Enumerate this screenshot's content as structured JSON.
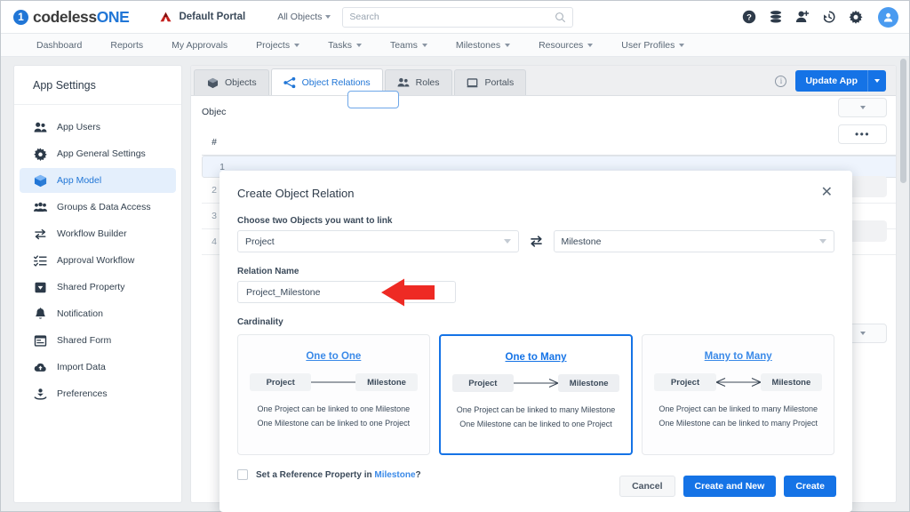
{
  "topbar": {
    "brand_mark": "1",
    "brand_primary": "codeless",
    "brand_accent": "ONE",
    "portal_name": "Default Portal",
    "portal_icon": "triangle-logo-icon",
    "object_selector": "All Objects",
    "search_placeholder": "Search",
    "search_value": "",
    "icons": [
      {
        "name": "help-icon",
        "glyph": "?"
      },
      {
        "name": "database-icon",
        "glyph": ""
      },
      {
        "name": "add-user-icon",
        "glyph": ""
      },
      {
        "name": "history-icon",
        "glyph": ""
      },
      {
        "name": "settings-gear-icon",
        "glyph": ""
      },
      {
        "name": "user-avatar-icon",
        "glyph": ""
      }
    ]
  },
  "nav": {
    "items": [
      {
        "label": "Dashboard",
        "has_caret": false
      },
      {
        "label": "Reports",
        "has_caret": false
      },
      {
        "label": "My Approvals",
        "has_caret": false
      },
      {
        "label": "Projects",
        "has_caret": true
      },
      {
        "label": "Tasks",
        "has_caret": true
      },
      {
        "label": "Teams",
        "has_caret": true
      },
      {
        "label": "Milestones",
        "has_caret": true
      },
      {
        "label": "Resources",
        "has_caret": true
      },
      {
        "label": "User Profiles",
        "has_caret": true
      }
    ]
  },
  "sidebar": {
    "title": "App Settings",
    "items": [
      {
        "label": "App Users",
        "icon": "users-icon",
        "active": false
      },
      {
        "label": "App General Settings",
        "icon": "gear-icon",
        "active": false
      },
      {
        "label": "App Model",
        "icon": "cube-icon",
        "active": true
      },
      {
        "label": "Groups & Data Access",
        "icon": "group-users-icon",
        "active": false
      },
      {
        "label": "Workflow Builder",
        "icon": "swap-arrows-icon",
        "active": false
      },
      {
        "label": "Approval Workflow",
        "icon": "checklist-icon",
        "active": false
      },
      {
        "label": "Shared Property",
        "icon": "tag-down-icon",
        "active": false
      },
      {
        "label": "Notification",
        "icon": "bell-icon",
        "active": false
      },
      {
        "label": "Shared Form",
        "icon": "form-icon",
        "active": false
      },
      {
        "label": "Import Data",
        "icon": "cloud-upload-icon",
        "active": false
      },
      {
        "label": "Preferences",
        "icon": "preferences-hand-icon",
        "active": false
      }
    ]
  },
  "main": {
    "tabs": [
      {
        "label": "Objects",
        "icon": "cube-icon",
        "active": false
      },
      {
        "label": "Object Relations",
        "icon": "relations-icon",
        "active": true
      },
      {
        "label": "Roles",
        "icon": "roles-users-icon",
        "active": false
      },
      {
        "label": "Portals",
        "icon": "portal-screen-icon",
        "active": false
      }
    ],
    "info_icon": "info-icon",
    "update_button": "Update App",
    "background": {
      "section_label": "Objec",
      "table_header": "#",
      "rows": [
        "1",
        "2",
        "3",
        "4"
      ],
      "more_actions": "•••"
    }
  },
  "modal": {
    "title": "Create Object Relation",
    "close_icon": "close-icon",
    "objects_label": "Choose two Objects you want to link",
    "object_left": "Project",
    "object_right": "Milestone",
    "swap_icon": "swap-arrows-icon",
    "relation_name_label": "Relation Name",
    "relation_name_value": "Project_Milestone",
    "cardinality_label": "Cardinality",
    "cards": [
      {
        "title": "One to One",
        "left": "Project",
        "right": "Milestone",
        "connector": "line",
        "line1": "One Project can be linked to one Milestone",
        "line2": "One Milestone can be linked to one Project",
        "selected": false
      },
      {
        "title": "One to Many",
        "left": "Project",
        "right": "Milestone",
        "connector": "crowfoot-right",
        "line1": "One Project can be linked to many Milestone",
        "line2": "One Milestone can be linked to one Project",
        "selected": true
      },
      {
        "title": "Many to Many",
        "left": "Project",
        "right": "Milestone",
        "connector": "crowfoot-both",
        "line1": "One Project can be linked to many Milestone",
        "line2": "One Milestone can be linked to many Project",
        "selected": false
      }
    ],
    "checkbox_checked": false,
    "checkbox_text_before": "Set a Reference Property in",
    "checkbox_link": "Milestone",
    "checkbox_text_after": "?",
    "buttons": {
      "cancel": "Cancel",
      "create_and_new": "Create and New",
      "create": "Create"
    }
  },
  "annotation": {
    "arrow": "red-left-arrow",
    "arrow_color": "#ee2a24"
  },
  "colors": {
    "accent_blue": "#1573e6",
    "link_blue": "#3b8ae8",
    "text_dark": "#2e3b4a",
    "arrow_red": "#ee2a24"
  }
}
